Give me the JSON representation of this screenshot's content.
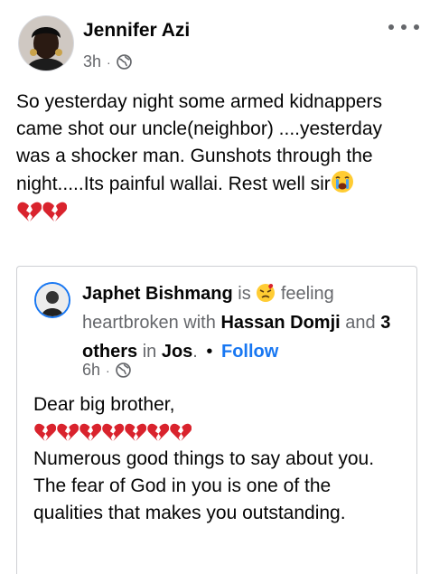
{
  "post": {
    "author": "Jennifer Azi",
    "time": "3h",
    "separator": "·",
    "privacy_icon": "globe-icon",
    "more_icon": "more-options-icon",
    "text": "So yesterday night some armed kidnappers came shot our uncle(neighbor) ....yesterday was a shocker man. Gunshots through the night.....Its painful wallai. Rest well sir",
    "emojis": [
      "crying-face-icon",
      "broken-heart-icon",
      "broken-heart-icon"
    ]
  },
  "shared": {
    "author": "Japhet Bishmang",
    "is_text": "is",
    "feeling_emoji": "heartbroken-face-icon",
    "feeling_text": "feeling heartbroken with",
    "with_person": "Hassan Domji",
    "and_text": "and",
    "others": "3 others",
    "in_text": "in",
    "location": "Jos",
    "period": ".",
    "bullet": "•",
    "follow": "Follow",
    "time": "6h",
    "separator": "·",
    "greeting": "Dear big brother,",
    "hearts_count": 7,
    "line1": "Numerous good things to say about you.",
    "line2": "The fear of God in you is one of the qualities that makes you outstanding."
  },
  "colors": {
    "text": "#050505",
    "secondary": "#65676b",
    "link": "#1877f2",
    "border": "#ced0d4",
    "heart": "#d9232d"
  }
}
